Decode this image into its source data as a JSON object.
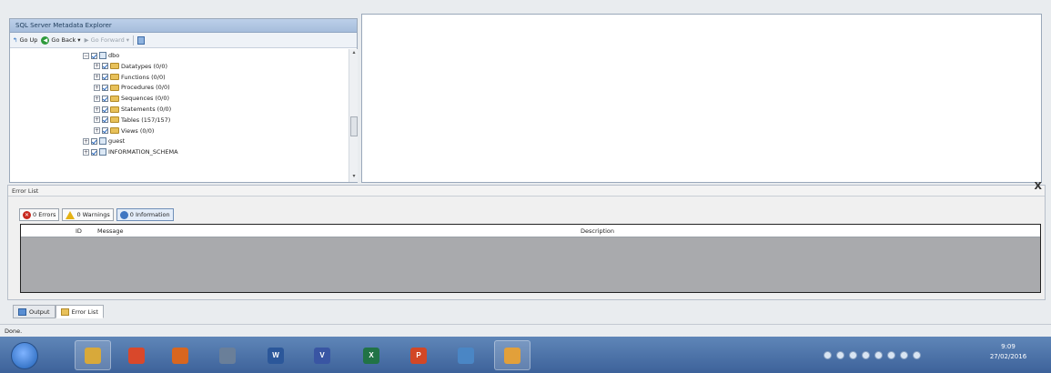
{
  "explorer": {
    "title": "SQL Server Metadata Explorer",
    "toolbar": {
      "go_up": "Go Up",
      "go_back": "Go Back",
      "go_forward": "Go Forward"
    },
    "tree": [
      {
        "label": "dbo",
        "kind": "schema",
        "level": 0,
        "expander": "−"
      },
      {
        "label": "Datatypes (0/0)",
        "kind": "folder",
        "level": 1,
        "expander": "+"
      },
      {
        "label": "Functions (0/0)",
        "kind": "folder",
        "level": 1,
        "expander": "+"
      },
      {
        "label": "Procedures (0/0)",
        "kind": "folder",
        "level": 1,
        "expander": "+"
      },
      {
        "label": "Sequences (0/0)",
        "kind": "folder",
        "level": 1,
        "expander": "+"
      },
      {
        "label": "Statements (0/0)",
        "kind": "folder",
        "level": 1,
        "expander": "+"
      },
      {
        "label": "Tables (157/157)",
        "kind": "folder",
        "level": 1,
        "expander": "+"
      },
      {
        "label": "Views (0/0)",
        "kind": "folder",
        "level": 1,
        "expander": "+"
      },
      {
        "label": "guest",
        "kind": "schema",
        "level": 0,
        "expander": "+"
      },
      {
        "label": "INFORMATION_SCHEMA",
        "kind": "schema",
        "level": 0,
        "expander": "+"
      }
    ]
  },
  "error_list": {
    "title": "Error List",
    "close": "X",
    "filters": {
      "errors": "0 Errors",
      "warnings": "0 Warnings",
      "information": "0 Information"
    },
    "columns": {
      "id": "ID",
      "message": "Message",
      "description": "Description"
    }
  },
  "bottom_tabs": {
    "output": "Output",
    "error_list": "Error List"
  },
  "status": "Done.",
  "taskbar": {
    "apps": [
      {
        "name": "explorer",
        "glyph": "",
        "color": "#d8a93a"
      },
      {
        "name": "chrome",
        "glyph": "",
        "color": "#d9482b"
      },
      {
        "name": "firefox",
        "glyph": "",
        "color": "#d8661f"
      },
      {
        "name": "search",
        "glyph": "",
        "color": "#6a7f99"
      },
      {
        "name": "word",
        "glyph": "W",
        "color": "#2b579a"
      },
      {
        "name": "visio",
        "glyph": "V",
        "color": "#3955a3"
      },
      {
        "name": "excel",
        "glyph": "X",
        "color": "#217346"
      },
      {
        "name": "powerpoint",
        "glyph": "P",
        "color": "#d24726"
      },
      {
        "name": "tool",
        "glyph": "",
        "color": "#4a86c5"
      },
      {
        "name": "metadata-explorer",
        "glyph": "",
        "color": "#e2a03a"
      }
    ],
    "clock_time": "9:09",
    "clock_date": "27/02/2016"
  }
}
